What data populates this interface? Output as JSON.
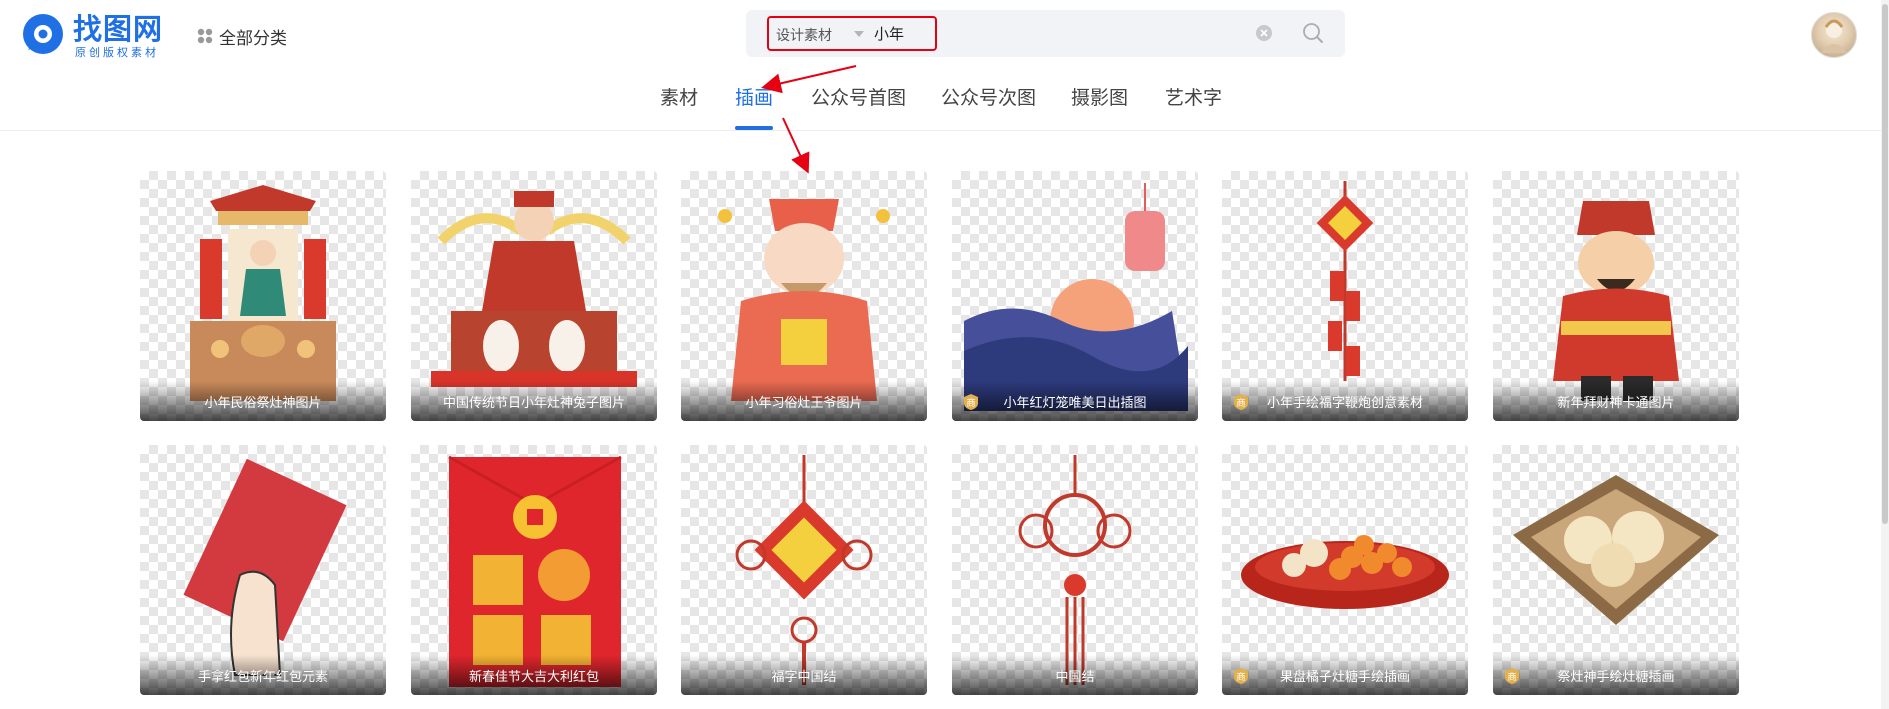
{
  "brand": {
    "name": "找图网",
    "slogan": "原创版权素材"
  },
  "category_all": "全部分类",
  "search": {
    "type": "设计素材",
    "query": "小年"
  },
  "tabs": [
    {
      "label": "素材",
      "active": false
    },
    {
      "label": "插画",
      "active": true
    },
    {
      "label": "公众号首图",
      "active": false
    },
    {
      "label": "公众号次图",
      "active": false
    },
    {
      "label": "摄影图",
      "active": false
    },
    {
      "label": "艺术字",
      "active": false
    }
  ],
  "colors": {
    "brand": "#1f6fe5",
    "annotation": "#e60012"
  },
  "commercial_badge_text": "商",
  "cards": [
    {
      "title": "小年民俗祭灶神图片",
      "commercial": false,
      "icon": "kitchen-god-altar"
    },
    {
      "title": "中国传统节日小年灶神兔子图片",
      "commercial": false,
      "icon": "kitchen-god-rabbits"
    },
    {
      "title": "小年习俗灶王爷图片",
      "commercial": false,
      "icon": "kitchen-god"
    },
    {
      "title": "小年红灯笼唯美日出插图",
      "commercial": true,
      "icon": "lantern-sunrise"
    },
    {
      "title": "小年手绘福字鞭炮创意素材",
      "commercial": true,
      "icon": "fu-firecrackers"
    },
    {
      "title": "新年拜财神卡通图片",
      "commercial": false,
      "icon": "god-of-wealth"
    },
    {
      "title": "手拿红包新年红包元素",
      "commercial": false,
      "icon": "red-envelope-hand"
    },
    {
      "title": "新春佳节大吉大利红包",
      "commercial": false,
      "icon": "red-envelope"
    },
    {
      "title": "福字中国结",
      "commercial": false,
      "icon": "fu-chinese-knot"
    },
    {
      "title": "中国结",
      "commercial": false,
      "icon": "chinese-knot"
    },
    {
      "title": "果盘橘子灶糖手绘插画",
      "commercial": true,
      "icon": "fruit-plate"
    },
    {
      "title": "祭灶神手绘灶糖插画",
      "commercial": true,
      "icon": "candy-tray"
    }
  ]
}
